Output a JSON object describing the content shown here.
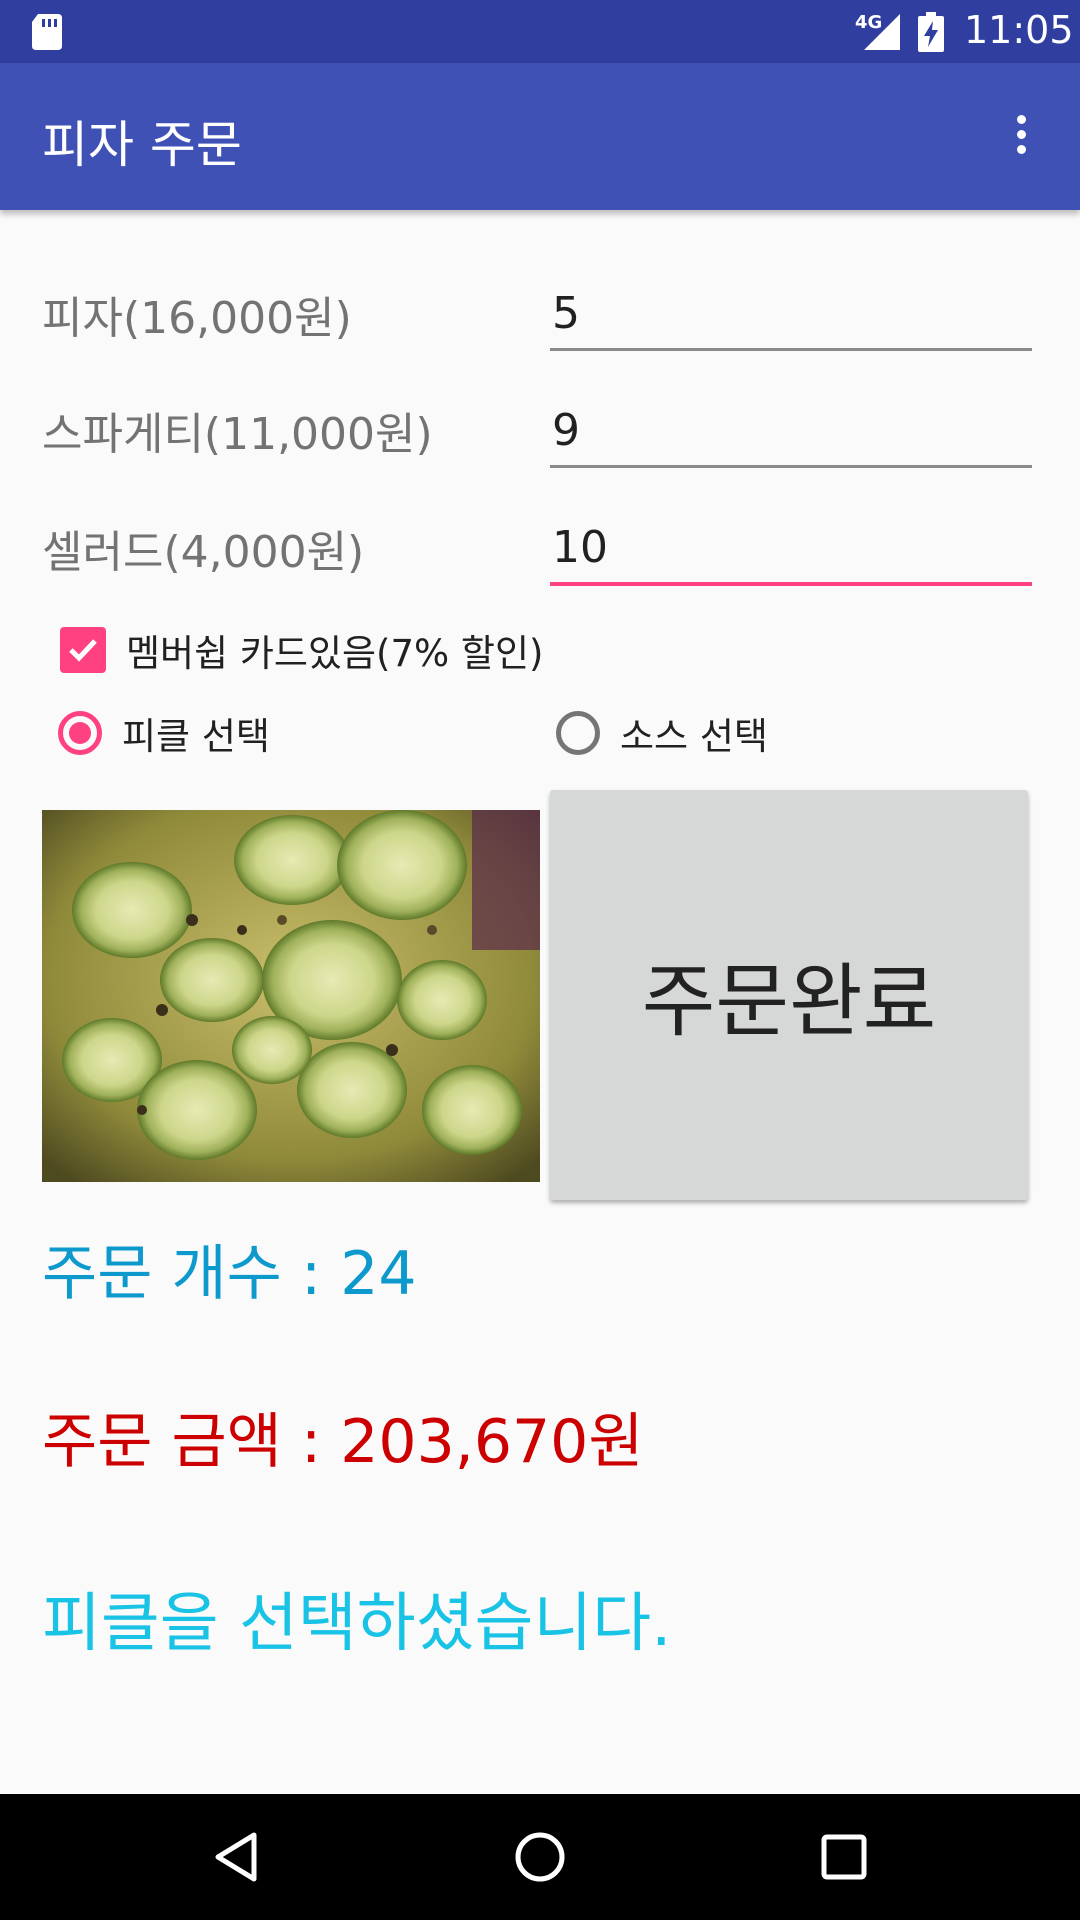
{
  "status_bar": {
    "network_label": "4G",
    "time": "11:05",
    "icons": [
      "sd-card-icon",
      "signal-icon",
      "battery-charging-icon"
    ]
  },
  "app_bar": {
    "title": "피자 주문",
    "overflow_icon": "more-vert-icon"
  },
  "order_form": {
    "pizza": {
      "label": "피자(16,000원)",
      "quantity": "5"
    },
    "spaghetti": {
      "label": "스파게티(11,000원)",
      "quantity": "9"
    },
    "salad": {
      "label": "셀러드(4,000원)",
      "quantity": "10"
    },
    "membership": {
      "label": "멤버쉽 카드있음(7% 할인)",
      "checked": true
    },
    "pickle_option": {
      "label": "피클 선택",
      "selected": true
    },
    "sauce_option": {
      "label": "소스 선택",
      "selected": false
    },
    "submit_label": "주문완료"
  },
  "summary": {
    "count_text": "주문 개수 : 24",
    "amount_text": "주문 금액 : 203,670원",
    "message_text": "피클을 선택하셨습니다."
  },
  "nav_bar": {
    "icons": [
      "back-icon",
      "home-icon",
      "recents-icon"
    ]
  },
  "colors": {
    "status_bar": "#303f9f",
    "app_bar": "#3f51b5",
    "accent": "#ff4081",
    "count_text": "#0d99cc",
    "amount_text": "#cc0000",
    "message_text": "#19c3e6"
  }
}
